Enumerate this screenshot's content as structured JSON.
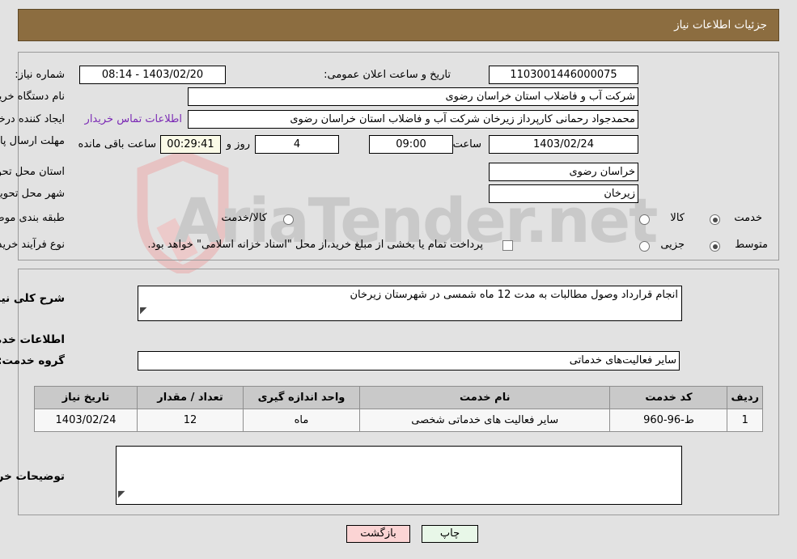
{
  "header": {
    "title": "جزئیات اطلاعات نیاز"
  },
  "form": {
    "need_number": {
      "label": "شماره نیاز:",
      "value": "1103001446000075"
    },
    "announce_datetime": {
      "label": "تاریخ و ساعت اعلان عمومی:",
      "value": "1403/02/20 - 08:14"
    },
    "buyer_org": {
      "label": "نام دستگاه خریدار:",
      "value": "شرکت آب و فاضلاب استان خراسان رضوی"
    },
    "request_creator": {
      "label": "ایجاد کننده درخواست:",
      "value": "محمدجواد رحمانی کارپرداز زیرخان  شرکت آب و فاضلاب استان خراسان رضوی",
      "contact_link": "اطلاعات تماس خریدار"
    },
    "response_deadline": {
      "label": "مهلت ارسال پاسخ: تا تاریخ:",
      "date": "1403/02/24",
      "hour_label": "ساعت",
      "hour": "09:00",
      "days": "4",
      "days_suffix_label": "روز و",
      "countdown": "00:29:41",
      "countdown_suffix_label": "ساعت باقی مانده"
    },
    "delivery_province": {
      "label": "استان محل تحویل:",
      "value": "خراسان رضوی"
    },
    "delivery_city": {
      "label": "شهر محل تحویل:",
      "value": "زیرخان"
    },
    "subject_classification": {
      "label": "طبقه بندی موضوعی:",
      "options": [
        "کالا",
        "خدمت",
        "کالا/خدمت"
      ],
      "selected": "خدمت"
    },
    "purchase_process_type": {
      "label": "نوع فرآیند خرید :",
      "options": [
        "جزیی",
        "متوسط"
      ],
      "selected": "متوسط"
    },
    "treasury_note": {
      "checked": false,
      "text": "پرداخت تمام یا بخشی از مبلغ خرید،از محل \"اسناد خزانه اسلامی\" خواهد بود."
    }
  },
  "needs": {
    "summary_label": "شرح کلی نیاز:",
    "summary_value": "انجام قرارداد وصول مطالبات به مدت 12 ماه شمسی در شهرستان زیرخان",
    "services_heading": "اطلاعات خدمات مورد نیاز",
    "service_group_label": "گروه خدمت:",
    "service_group_value": "سایر فعالیت‌های خدماتی"
  },
  "table": {
    "columns": [
      "ردیف",
      "کد خدمت",
      "نام خدمت",
      "واحد اندازه گیری",
      "تعداد / مقدار",
      "تاریخ نیاز"
    ],
    "rows": [
      {
        "row_no": "1",
        "service_code": "ط-96-960",
        "service_name": "سایر فعالیت های خدماتی شخصی",
        "unit": "ماه",
        "quantity": "12",
        "need_date": "1403/02/24"
      }
    ]
  },
  "buyer_comments": {
    "label": "توضیحات خریدار:",
    "value": ""
  },
  "buttons": {
    "print": "چاپ",
    "back": "بازگشت"
  },
  "watermark": {
    "text": "AriaTender.net"
  }
}
